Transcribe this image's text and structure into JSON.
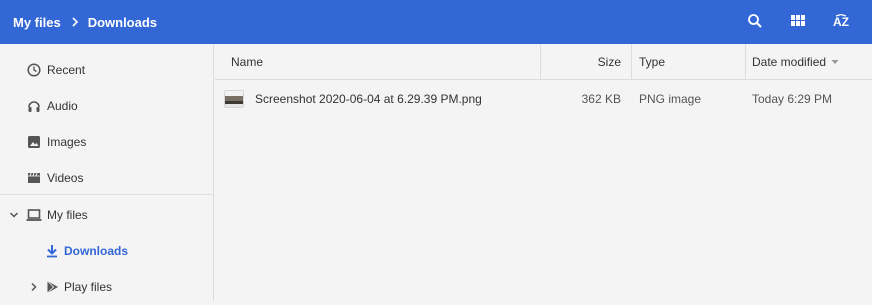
{
  "breadcrumb": {
    "root": "My files",
    "current": "Downloads"
  },
  "toolbar": {
    "search_icon": "search-icon",
    "view_icon": "grid-view-icon",
    "sort_icon": "sort-az-icon",
    "sort_text": "AZ"
  },
  "sidebar": {
    "items": [
      {
        "label": "Recent",
        "icon": "clock-icon"
      },
      {
        "label": "Audio",
        "icon": "headphones-icon"
      },
      {
        "label": "Images",
        "icon": "image-icon"
      },
      {
        "label": "Videos",
        "icon": "film-icon"
      },
      {
        "label": "My files",
        "icon": "laptop-icon",
        "expanded": true
      },
      {
        "label": "Downloads",
        "icon": "download-icon",
        "selected": true
      },
      {
        "label": "Play files",
        "icon": "play-store-icon",
        "expanded": false
      }
    ]
  },
  "columns": {
    "name": "Name",
    "size": "Size",
    "type": "Type",
    "date": "Date modified"
  },
  "files": [
    {
      "name": "Screenshot 2020-06-04 at 6.29.39 PM.png",
      "size": "362 KB",
      "type": "PNG image",
      "date": "Today 6:29 PM"
    }
  ],
  "colors": {
    "topbar": "#3367d6",
    "accent": "#3367d6",
    "background": "#f4f4f4"
  }
}
